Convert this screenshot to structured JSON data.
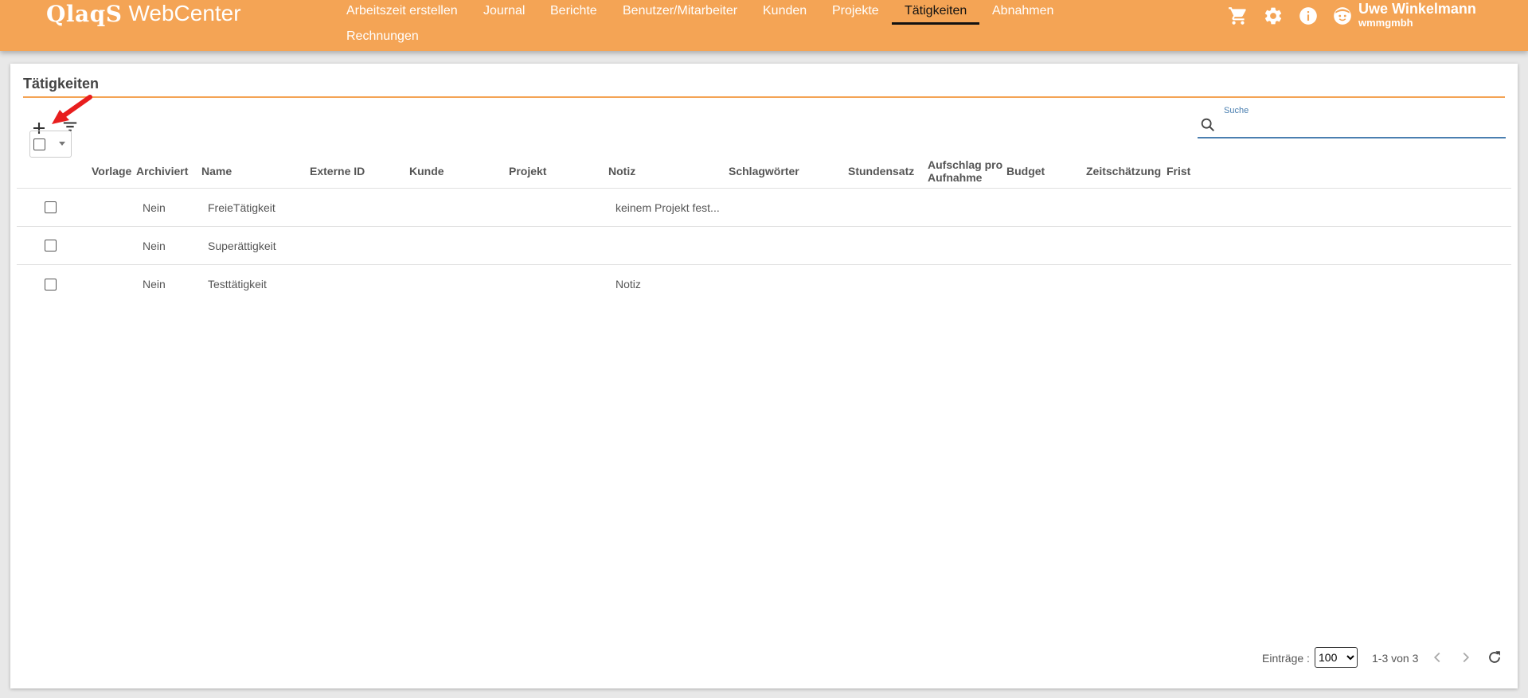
{
  "app": {
    "logo_brand": "QlaqS",
    "logo_suffix": "WebCenter"
  },
  "nav": {
    "items": [
      {
        "label": "Arbeitszeit erstellen"
      },
      {
        "label": "Journal"
      },
      {
        "label": "Berichte"
      },
      {
        "label": "Benutzer/Mitarbeiter"
      },
      {
        "label": "Kunden"
      },
      {
        "label": "Projekte"
      },
      {
        "label": "Tätigkeiten",
        "active": true
      },
      {
        "label": "Abnahmen"
      },
      {
        "label": "Rechnungen"
      }
    ]
  },
  "header_icons": [
    "cart-icon",
    "gear-icon",
    "info-icon",
    "avatar-icon"
  ],
  "user": {
    "name": "Uwe Winkelmann",
    "org": "wmmgmbh"
  },
  "page": {
    "title": "Tätigkeiten"
  },
  "toolbar": {
    "icons": [
      "add-icon",
      "filter-icon"
    ]
  },
  "search": {
    "label": "Suche",
    "value": ""
  },
  "table": {
    "columns": [
      "Vorlage",
      "Archiviert",
      "Name",
      "Externe ID",
      "Kunde",
      "Projekt",
      "Notiz",
      "Schlagwörter",
      "Stundensatz",
      "Aufschlag pro Aufnahme",
      "Budget",
      "Zeitschätzung",
      "Frist"
    ],
    "rows": [
      {
        "vorlage": "",
        "archiviert": "Nein",
        "name": "FreieTätigkeit",
        "externe_id": "",
        "kunde": "",
        "projekt": "",
        "notiz": "keinem Projekt fest...",
        "schlagwoerter": "",
        "stundensatz": "",
        "aufschlag": "",
        "budget": "",
        "zeitschaetzung": "",
        "frist": ""
      },
      {
        "vorlage": "",
        "archiviert": "Nein",
        "name": "Superättigkeit",
        "externe_id": "",
        "kunde": "",
        "projekt": "",
        "notiz": "",
        "schlagwoerter": "",
        "stundensatz": "",
        "aufschlag": "",
        "budget": "",
        "zeitschaetzung": "",
        "frist": ""
      },
      {
        "vorlage": "",
        "archiviert": "Nein",
        "name": "Testtätigkeit",
        "externe_id": "",
        "kunde": "",
        "projekt": "",
        "notiz": "Notiz",
        "schlagwoerter": "",
        "stundensatz": "",
        "aufschlag": "",
        "budget": "",
        "zeitschaetzung": "",
        "frist": ""
      }
    ]
  },
  "paginator": {
    "label": "Einträge :",
    "page_size": "100",
    "page_size_options": [
      "100"
    ],
    "range": "1-3 von 3"
  },
  "colors": {
    "header": "#f4a455",
    "accent_line": "#f4a455",
    "search_underline": "#4a7fb0",
    "annotation_arrow": "#e81e1e"
  }
}
